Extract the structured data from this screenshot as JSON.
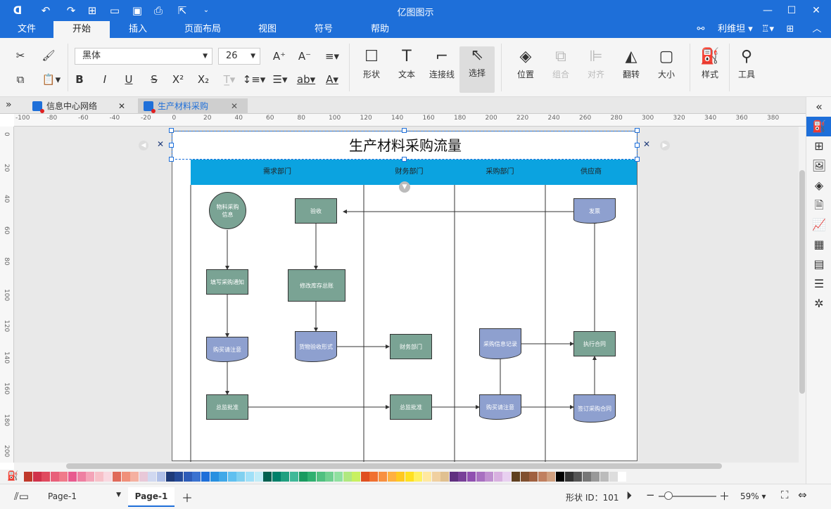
{
  "app": {
    "title": "亿图图示"
  },
  "menu": {
    "tabs": [
      "文件",
      "开始",
      "插入",
      "页面布局",
      "视图",
      "符号",
      "帮助"
    ],
    "active": "开始",
    "user": "利维坦"
  },
  "ribbon": {
    "font_family": "黑体",
    "font_size": "26",
    "big_buttons": {
      "shape": "形状",
      "text": "文本",
      "connector": "连接线",
      "select": "选择",
      "position": "位置",
      "group": "组合",
      "align": "对齐",
      "flip": "翻转",
      "size": "大小",
      "style": "样式",
      "tools": "工具"
    }
  },
  "doc_tabs": [
    {
      "label": "信息中心网络"
    },
    {
      "label": "生产材料采购"
    }
  ],
  "rulers": {
    "h": [
      "-100",
      "-80",
      "-60",
      "-40",
      "-20",
      "0",
      "20",
      "40",
      "60",
      "80",
      "100",
      "120",
      "140",
      "160",
      "180",
      "200",
      "220",
      "240",
      "260",
      "280",
      "300",
      "320",
      "340",
      "360",
      "380"
    ],
    "v": [
      "0",
      "20",
      "40",
      "60",
      "80",
      "100",
      "120",
      "140",
      "160",
      "180",
      "200"
    ]
  },
  "diagram": {
    "title": "生产材料采购流量",
    "lanes": [
      "需求部门",
      "财务部门",
      "采购部门",
      "供应商"
    ],
    "nodes": {
      "n1": "物料采购信息",
      "n2": "验收",
      "n3": "发票",
      "n4": "填写采购通知",
      "n5": "修改库存总账",
      "n6": "购买请注意",
      "n7": "货物验收形式",
      "n8": "财务部门",
      "n9": "采购信息记录",
      "n10": "执行合同",
      "n11": "总监批准",
      "n12": "总监批准",
      "n13": "购买请注意",
      "n14": "签订采购合同"
    }
  },
  "colors": {
    "accent": "#1e6fd9",
    "lane_header": "#0ba3e0",
    "process": "#7aa394",
    "document": "#8ea0cf"
  },
  "palette": [
    "#c0392b",
    "#d0324a",
    "#e04a5e",
    "#e8607a",
    "#f07a8a",
    "#e85a8f",
    "#ee80a2",
    "#f4a4b8",
    "#f7c0c8",
    "#f9d8e0",
    "#e06a5a",
    "#f0907a",
    "#f5b0a0",
    "#e8c8d8",
    "#d0d8f0",
    "#b0c0e8",
    "#1e3a78",
    "#254a98",
    "#2e5cb8",
    "#3a72d0",
    "#1e6fd9",
    "#2890e0",
    "#40a8e8",
    "#60c0f0",
    "#80d0f0",
    "#a0e0f8",
    "#c0ecf8",
    "#006050",
    "#00806a",
    "#20a080",
    "#40b898",
    "#1a9a60",
    "#30b070",
    "#50c080",
    "#70d090",
    "#90e0a0",
    "#b0e880",
    "#c8f060",
    "#e05020",
    "#f07030",
    "#f89040",
    "#ffb040",
    "#ffc820",
    "#ffe020",
    "#fff060",
    "#ffe8a0",
    "#f0d0a0",
    "#e0c090",
    "#603080",
    "#784098",
    "#9050b0",
    "#a870c0",
    "#c090d0",
    "#d8b0e0",
    "#e8d0f0",
    "#604020",
    "#805030",
    "#a06040",
    "#c08060",
    "#d0a080",
    "#000000",
    "#333333",
    "#555555",
    "#777777",
    "#999999",
    "#bbbbbb",
    "#dddddd",
    "#ffffff"
  ],
  "status": {
    "page_tab": "Page-1",
    "page_active": "Page-1",
    "shape_id": "形状 ID：101",
    "zoom": "59%"
  }
}
